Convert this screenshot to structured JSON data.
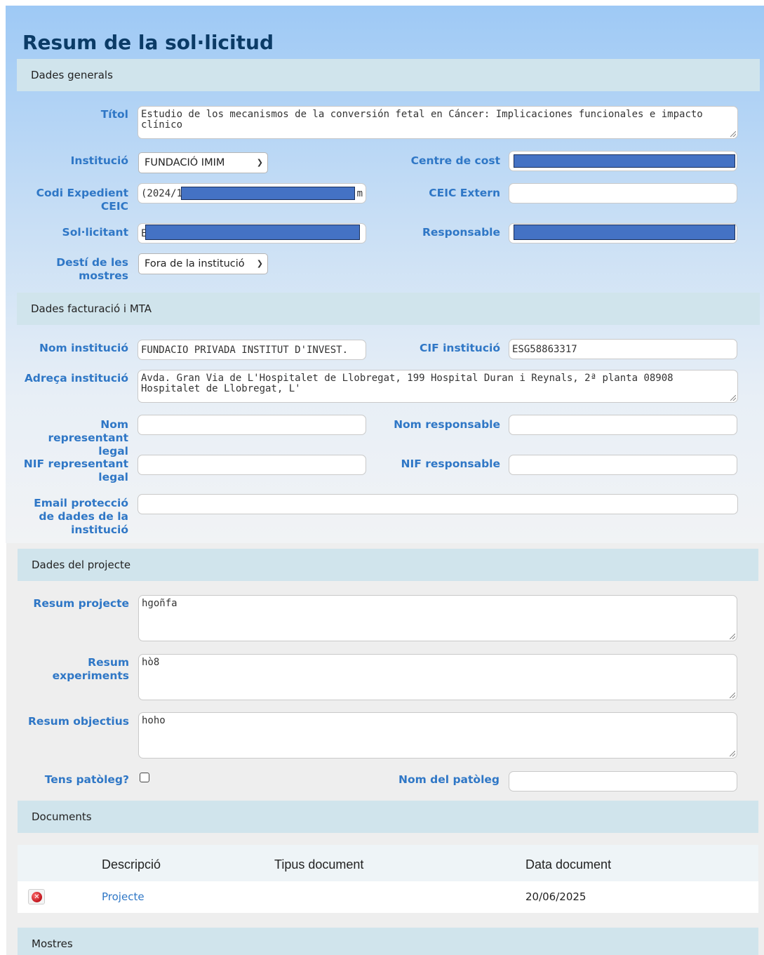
{
  "page": {
    "title": "Resum de la sol·licitud"
  },
  "sections": {
    "general": "Dades generals",
    "billing": "Dades facturació i MTA",
    "project": "Dades del projecte",
    "documents": "Documents",
    "samples": "Mostres"
  },
  "general": {
    "titol_label": "Títol",
    "titol_value": "Estudio de los mecanismos de la conversión fetal en Cáncer: Implicaciones funcionales e impacto clínico",
    "institucio_label": "Institució",
    "institucio_value": "FUNDACIÓ IMIM",
    "centre_cost_label": "Centre de cost",
    "codi_label": "Codi Expedient CEIC",
    "codi_prefix": "(2024/1",
    "codi_suffix": "m",
    "ceic_extern_label": "CEIC Extern",
    "sollicitant_label": "Sol·licitant",
    "sollicitant_prefix": "E",
    "responsable_label": "Responsable",
    "desti_label": "Destí de les mostres",
    "desti_value": "Fora de la institució"
  },
  "billing": {
    "nom_inst_label": "Nom institució",
    "nom_inst_value": "FUNDACIO PRIVADA INSTITUT D'INVEST.",
    "cif_label": "CIF institució",
    "cif_value": "ESG58863317",
    "adreca_label": "Adreça institució",
    "adreca_value": "Avda. Gran Via de L'Hospitalet de Llobregat, 199 Hospital Duran i Reynals, 2ª planta 08908 Hospitalet de Llobregat, L'",
    "nom_repr_label": "Nom representant legal",
    "nom_resp_label": "Nom responsable",
    "nif_repr_label": "NIF representant legal",
    "nif_resp_label": "NIF responsable",
    "email_label": "Email protecció de dades de la institució"
  },
  "project": {
    "resum_proj_label": "Resum projecte",
    "resum_proj_value": "hgoñfa",
    "resum_exp_label": "Resum experiments",
    "resum_exp_value": "hò8",
    "resum_obj_label": "Resum objectius",
    "resum_obj_value": "hoho",
    "pateleg_label": "Tens patòleg?",
    "nom_pateleg_label": "Nom del patòleg"
  },
  "documents": {
    "headers": [
      "Descripció",
      "Tipus document",
      "Data document"
    ],
    "rows": [
      {
        "descripcio": "Projecte",
        "tipus": "",
        "data": "20/06/2025"
      }
    ]
  },
  "icons": {
    "delete": "delete-icon",
    "dropdown": "chevron-down-icon"
  },
  "colors": {
    "label": "#2f77c6",
    "title": "#0b3b66",
    "section": "#d0e4ec",
    "redaction": "#4472c4"
  }
}
